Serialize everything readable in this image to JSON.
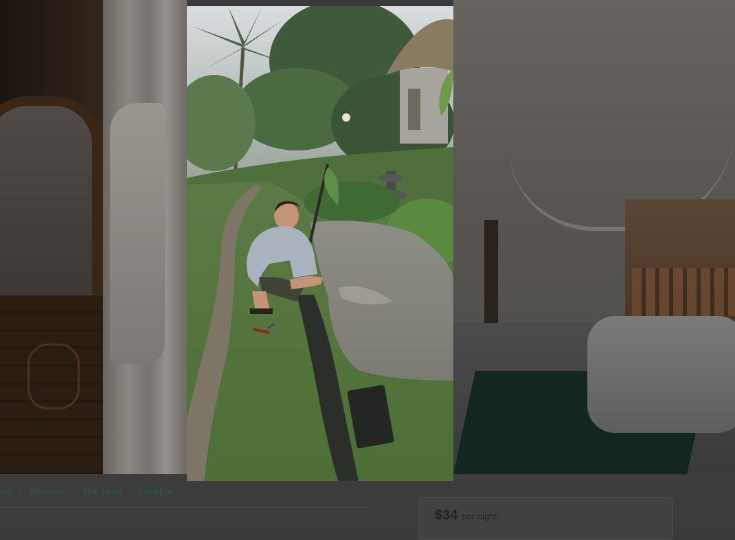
{
  "listing_nav": {
    "items": [
      {
        "label": "ew"
      },
      {
        "label": "Reviews"
      },
      {
        "label": "The Host"
      },
      {
        "label": "Location"
      }
    ],
    "separator": "·"
  },
  "booking": {
    "price": "$34",
    "price_unit": "per night"
  },
  "photo_viewer": {
    "current_photo": "guest crouching beside garden pond with fountain and thatched hut"
  },
  "colors": {
    "link": "#245a4e",
    "overlay": "#3a3a3a"
  }
}
